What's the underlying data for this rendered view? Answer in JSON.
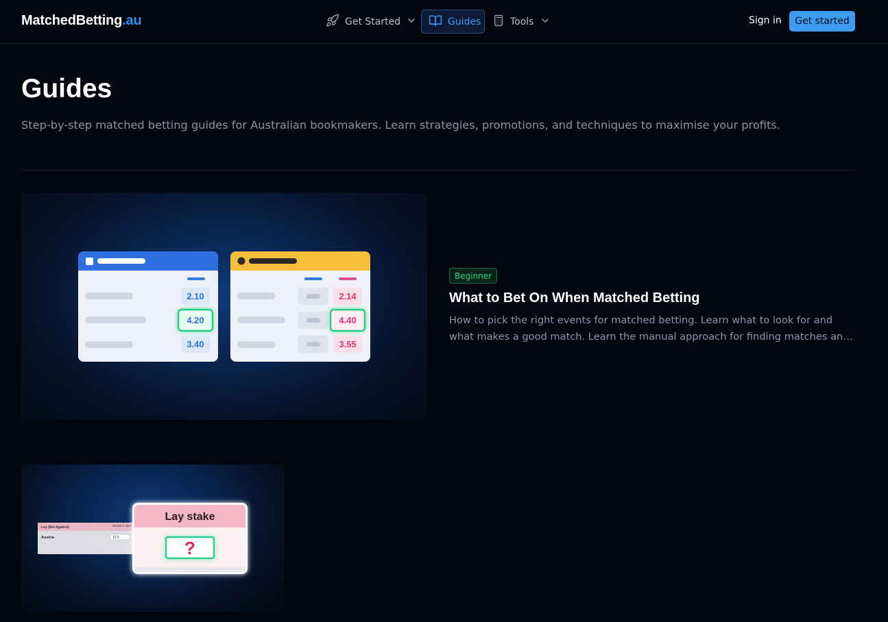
{
  "nav": {
    "logo_main": "MatchedBetting",
    "logo_tld": ".au",
    "items": [
      {
        "label": "Get Started",
        "icon": "rocket-icon",
        "has_dropdown": true
      },
      {
        "label": "Guides",
        "icon": "book-icon",
        "active": true
      },
      {
        "label": "Tools",
        "icon": "calculator-icon",
        "has_dropdown": true
      }
    ],
    "sign_in": "Sign in",
    "cta": "Get started"
  },
  "header": {
    "title": "Guides",
    "subtitle": "Step-by-step matched betting guides for Australian bookmakers. Learn strategies, promotions, and techniques to maximise your profits."
  },
  "guides": [
    {
      "badge": "Beginner",
      "title": "What to Bet On When Matched Betting",
      "description": "How to pick the right events for matched betting. Learn what to look for and what makes a good match. Learn the manual approach for finding matches and more.",
      "illustration": {
        "back_odds": [
          "2.10",
          "4.20",
          "3.40"
        ],
        "lay_odds": [
          "2.14",
          "4.40",
          "3.55"
        ]
      }
    },
    {
      "illustration": {
        "table_header_left": "Lay (Bet Against)",
        "table_header_right": "Backer's odds",
        "table_row_label": "Austria",
        "table_row_value": "12.5",
        "card_title": "Lay stake",
        "card_symbol": "?"
      }
    }
  ],
  "colors": {
    "background": "#03060f",
    "accent": "#3d9bf0",
    "badge_green": "#34d17e",
    "back_blue": "#2f6fe0",
    "lay_pink": "#e0337a",
    "highlight_green": "#20d08a"
  }
}
